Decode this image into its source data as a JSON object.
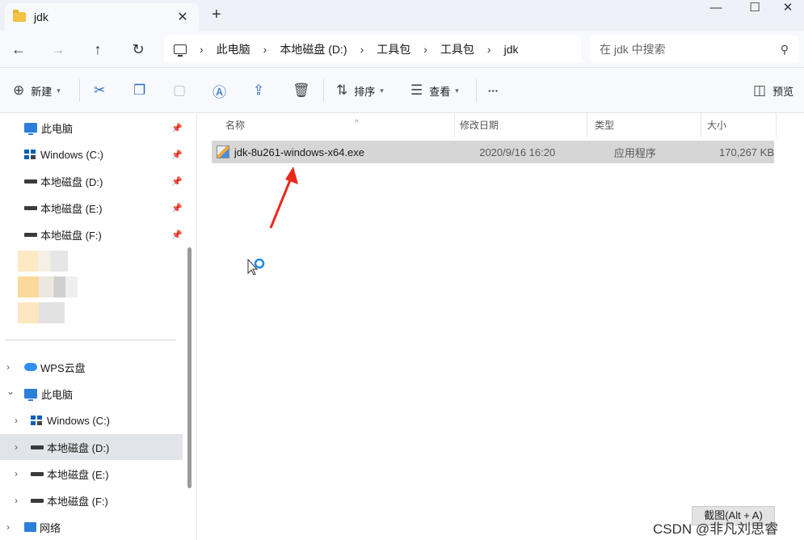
{
  "window": {
    "tab_title": "jdk",
    "new_tab": "+",
    "minimize": "—",
    "maximize": "☐",
    "close": "✕"
  },
  "nav": {
    "back": "←",
    "forward": "→",
    "up": "↑",
    "refresh": "↻",
    "breadcrumbs": [
      "此电脑",
      "本地磁盘 (D:)",
      "工具包",
      "工具包",
      "jdk"
    ],
    "search_placeholder": "在 jdk 中搜索"
  },
  "toolbar": {
    "new_label": "新建",
    "sort_label": "排序",
    "view_label": "查看",
    "more_label": "···",
    "preview_label": "预览"
  },
  "sidebar": {
    "quick_access": [
      {
        "label": "此电脑",
        "icon": "monitor-icon"
      },
      {
        "label": "Windows (C:)",
        "icon": "windows-drive-icon"
      },
      {
        "label": "本地磁盘 (D:)",
        "icon": "drive-icon"
      },
      {
        "label": "本地磁盘 (E:)",
        "icon": "drive-icon"
      },
      {
        "label": "本地磁盘 (F:)",
        "icon": "drive-icon"
      }
    ],
    "tree": [
      {
        "label": "WPS云盘",
        "icon": "cloud-icon",
        "chevron": "›"
      },
      {
        "label": "此电脑",
        "icon": "monitor-icon",
        "chevron": "⌄"
      },
      {
        "label": "Windows (C:)",
        "icon": "windows-drive-icon",
        "chevron": "›"
      },
      {
        "label": "本地磁盘 (D:)",
        "icon": "drive-icon",
        "chevron": "›"
      },
      {
        "label": "本地磁盘 (E:)",
        "icon": "drive-icon",
        "chevron": "›"
      },
      {
        "label": "本地磁盘 (F:)",
        "icon": "drive-icon",
        "chevron": "›"
      },
      {
        "label": "网络",
        "icon": "network-icon",
        "chevron": "›"
      }
    ]
  },
  "filelist": {
    "columns": [
      "名称",
      "修改日期",
      "类型",
      "大小"
    ],
    "sort_indicator": "^",
    "files": [
      {
        "name": "jdk-8u261-windows-x64.exe",
        "date": "2020/9/16 16:20",
        "type": "应用程序",
        "size": "170,267 KB"
      }
    ]
  },
  "overlay": {
    "capture_tip": "截图(Alt + A)",
    "watermark": "CSDN @非凡刘思睿"
  },
  "colors": {
    "arrow": "#e8291c",
    "selected_row": "#d6d6d6",
    "accent": "#2b7fd8"
  }
}
